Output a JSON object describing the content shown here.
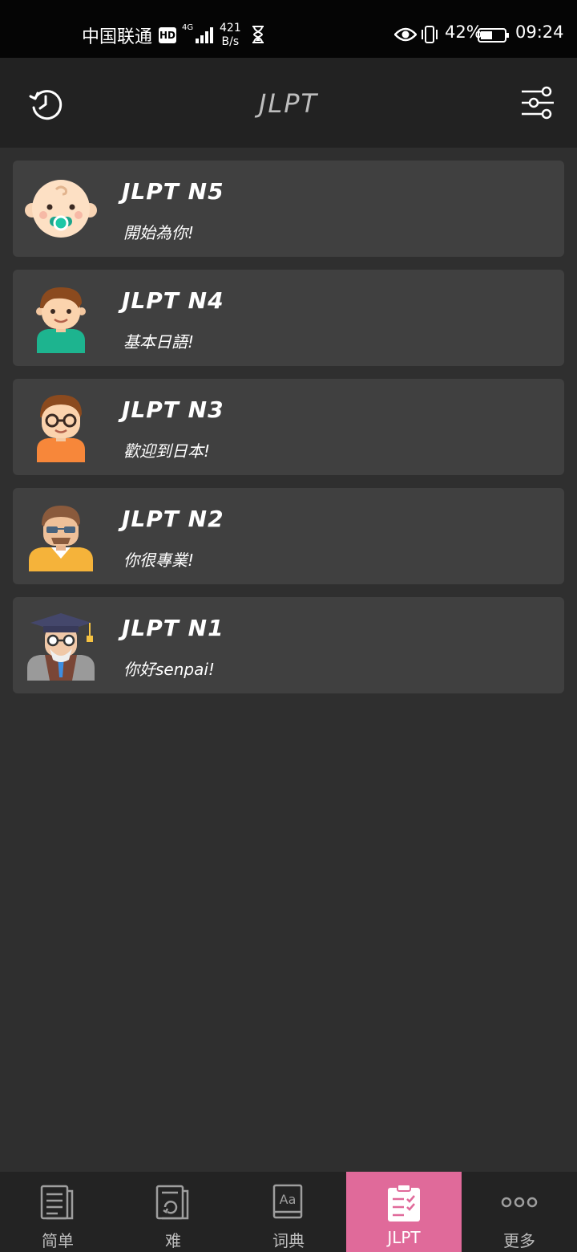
{
  "status_bar": {
    "carrier": "中国联通",
    "hd": "HD",
    "network_gen": "4G",
    "speed_value": "421",
    "speed_unit": "B/s",
    "battery_percent": "42%",
    "time": "09:24"
  },
  "app_bar": {
    "title": "JLPT",
    "left_icon": "history-icon",
    "right_icon": "filter-settings-icon"
  },
  "levels": [
    {
      "title": "JLPT N5",
      "subtitle": "開始為你!",
      "avatar": "baby-avatar-icon"
    },
    {
      "title": "JLPT N4",
      "subtitle": "基本日語!",
      "avatar": "boy-avatar-icon"
    },
    {
      "title": "JLPT N3",
      "subtitle": "歡迎到日本!",
      "avatar": "glasses-boy-avatar-icon"
    },
    {
      "title": "JLPT N2",
      "subtitle": "你很專業!",
      "avatar": "man-avatar-icon"
    },
    {
      "title": "JLPT N1",
      "subtitle": "你好senpai!",
      "avatar": "professor-avatar-icon"
    }
  ],
  "bottom_nav": {
    "items": [
      {
        "label": "简单",
        "icon": "book-list-icon"
      },
      {
        "label": "难",
        "icon": "book-refresh-icon"
      },
      {
        "label": "词典",
        "icon": "dictionary-icon"
      },
      {
        "label": "JLPT",
        "icon": "clipboard-check-icon",
        "active": true
      },
      {
        "label": "更多",
        "icon": "more-dots-icon"
      }
    ],
    "active_color": "#e06a9a"
  }
}
